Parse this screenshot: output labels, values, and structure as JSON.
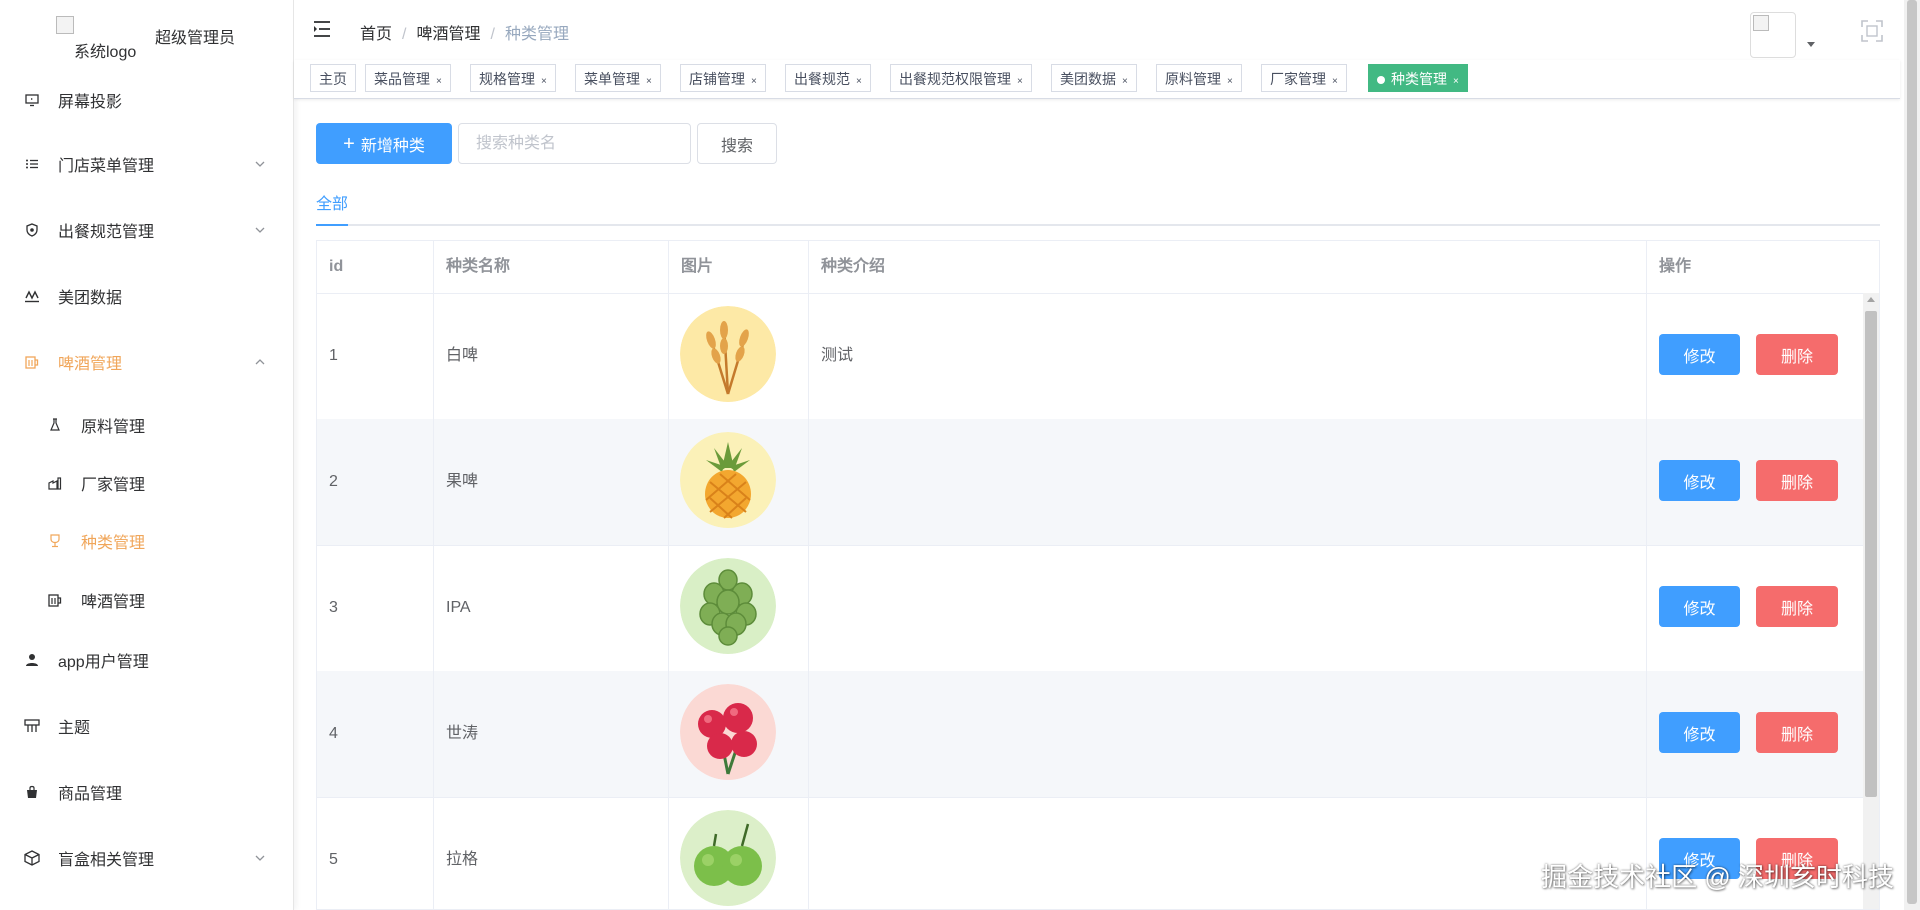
{
  "sidebar": {
    "logo_alt": "系统logo",
    "title": "超级管理员",
    "menu": [
      {
        "label": "屏幕投影",
        "icon": "monitor-icon"
      },
      {
        "label": "门店菜单管理",
        "icon": "list-icon"
      },
      {
        "label": "出餐规范管理",
        "icon": "shield-icon"
      },
      {
        "label": "美团数据",
        "icon": "scale-icon"
      },
      {
        "label": "啤酒管理",
        "icon": "beer-icon"
      },
      {
        "label": "app用户管理",
        "icon": "user-icon"
      },
      {
        "label": "主题",
        "icon": "theme-icon"
      },
      {
        "label": "商品管理",
        "icon": "bag-icon"
      },
      {
        "label": "盲盒相关管理",
        "icon": "box-icon"
      }
    ],
    "submenu": [
      {
        "label": "原料管理",
        "icon": "flask-icon"
      },
      {
        "label": "厂家管理",
        "icon": "factory-icon"
      },
      {
        "label": "种类管理",
        "icon": "goblet-icon"
      },
      {
        "label": "啤酒管理",
        "icon": "beer-icon"
      }
    ]
  },
  "header": {
    "breadcrumb": [
      "首页",
      "啤酒管理",
      "种类管理"
    ]
  },
  "tags": [
    "主页",
    "菜品管理",
    "规格管理",
    "菜单管理",
    "店铺管理",
    "出餐规范",
    "出餐规范权限管理",
    "美团数据",
    "原料管理",
    "厂家管理",
    "种类管理"
  ],
  "toolbar": {
    "add_label": "新增种类",
    "search_placeholder": "搜索种类名",
    "search_value": "",
    "search_label": "搜索"
  },
  "tabs": {
    "all": "全部"
  },
  "table": {
    "headers": {
      "id": "id",
      "name": "种类名称",
      "image": "图片",
      "desc": "种类介绍",
      "ops": "操作"
    },
    "edit_label": "修改",
    "delete_label": "删除",
    "rows": [
      {
        "id": "1",
        "name": "白啤",
        "desc": "测试",
        "image": "wheat-icon"
      },
      {
        "id": "2",
        "name": "果啤",
        "desc": "",
        "image": "pineapple-icon"
      },
      {
        "id": "3",
        "name": "IPA",
        "desc": "",
        "image": "hops-icon"
      },
      {
        "id": "4",
        "name": "世涛",
        "desc": "",
        "image": "cherries-icon"
      },
      {
        "id": "5",
        "name": "拉格",
        "desc": "",
        "image": "apples-icon"
      }
    ]
  },
  "watermark": "掘金技术社区 @ 深圳亥时科技",
  "colors": {
    "primary": "#409eff",
    "danger": "#f56c6c",
    "active_menu": "#f0a65a",
    "active_tag": "#42b983"
  }
}
